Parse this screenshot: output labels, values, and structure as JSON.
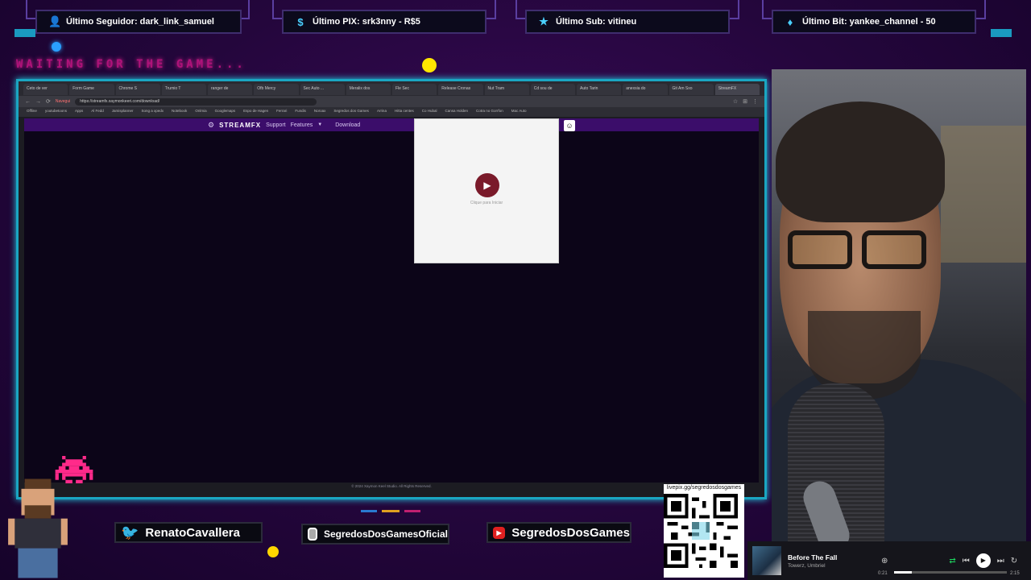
{
  "alerts": [
    {
      "icon": "user-icon",
      "text": "Último Seguidor: dark_link_samuel"
    },
    {
      "icon": "dollar-icon",
      "text": "Último PIX: srk3nny - R$5"
    },
    {
      "icon": "star-icon",
      "text": "Último Sub: vitineu"
    },
    {
      "icon": "diamond-icon",
      "text": "Último Bit: yankee_channel - 50"
    }
  ],
  "waiting_text": "WAITING FOR THE GAME...",
  "browser": {
    "tabs": [
      "Ceto de ver",
      "Form Game",
      "Chrome S",
      "Trumio T",
      "ranger de",
      "Ofb Mercy",
      "Sec Auto ...",
      "Meralix dos",
      "Fle Sec",
      "Release Cronas",
      "Nut Tram",
      "Cd sou de",
      "Auto Tarin",
      "anexsia do",
      "Git Am Sxo",
      "StreamFX"
    ],
    "url": "https://streamfx.xaymonkeeri.com/download/",
    "url_tag": "Navegui",
    "bookmarks": [
      "Offline",
      "youtubetoons",
      "Apps",
      "Al Fedd",
      "Jamisplanner",
      "Song a xpedx",
      "Notebook",
      "Onlmia",
      "Googlemaps",
      "Espo de Hagen",
      "Ferrari",
      "Fundis",
      "Noroax",
      "Segredos dos Games",
      "Arrina",
      "Hitta centes",
      "Co Hubal",
      "Cansa Holden",
      "Cotra no Gorrfon",
      "Mac Auto"
    ],
    "site": {
      "logo": "STREAMFX",
      "nav": [
        "Support",
        "Features",
        "Download"
      ],
      "video_hint": "Clique para Iniciar",
      "footer": "© 2024 Xaymon Keel Studio. All Rights Reserved."
    }
  },
  "socials": {
    "twitter": "RenatoCavallera",
    "instagram": "SegredosDosGamesOficial",
    "youtube": "SegredosDosGames"
  },
  "qr_label": "livepix.gg/segredosdosgames",
  "player": {
    "title": "Before The Fall",
    "artist": "Towerz, Umbriel",
    "elapsed": "0:21",
    "duration": "2:15",
    "progress": 0.16
  }
}
